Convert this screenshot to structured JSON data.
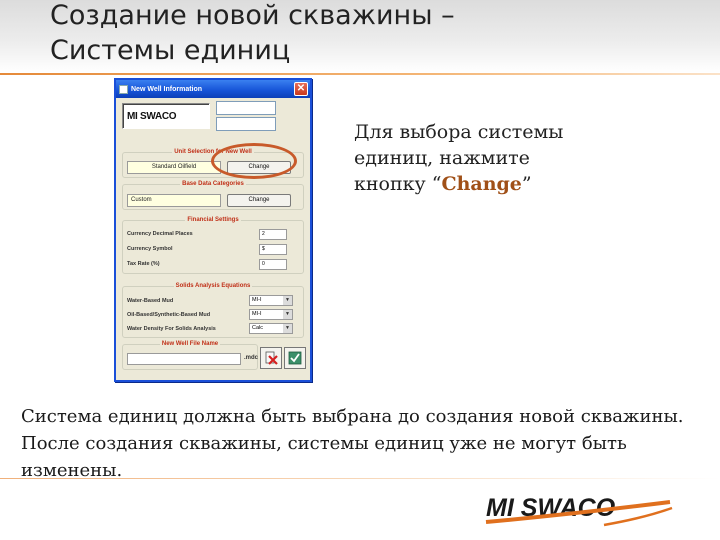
{
  "slide": {
    "title_line1": "Создание новой скважины –",
    "title_line2": "Системы единиц",
    "callout_line1": "Для выбора системы",
    "callout_line2": "единиц, нажмите",
    "callout_prefix": "кнопку “",
    "callout_accent": "Change",
    "callout_suffix": "”",
    "body": "Система единиц должна быть выбрана до создания новой скважины. После создания скважины, системы единиц уже не могут быть изменены.",
    "footer_logo": "MI SWACO"
  },
  "dialog": {
    "title": "New Well Information",
    "close_label": "✕",
    "logo": "MI SWACO",
    "unit_group": {
      "label": "Unit Selection for New Well",
      "value": "Standard Oilfield",
      "button": "Change"
    },
    "base_data_group": {
      "label": "Base Data Categories",
      "value": "Custom",
      "button": "Change"
    },
    "financial_group": {
      "label": "Financial Settings",
      "rows": [
        {
          "label": "Currency Decimal Places",
          "value": "2"
        },
        {
          "label": "Currency Symbol",
          "value": "$"
        },
        {
          "label": "Tax Rate (%)",
          "value": "0"
        }
      ]
    },
    "solids_group": {
      "label": "Solids Analysis Equations",
      "rows": [
        {
          "label": "Water-Based Mud",
          "value": "MI-I"
        },
        {
          "label": "Oil-Based/Synthetic-Based Mud",
          "value": "MI-I"
        },
        {
          "label": "Water Density For Solids Analysis",
          "value": "Calc"
        }
      ]
    },
    "filename_group": {
      "label": "New Well File Name",
      "extension": ".mdc"
    }
  },
  "colors": {
    "accent": "#c85a2a",
    "dialog_title": "#1552d6",
    "dialog_bg": "#ece9d8"
  }
}
